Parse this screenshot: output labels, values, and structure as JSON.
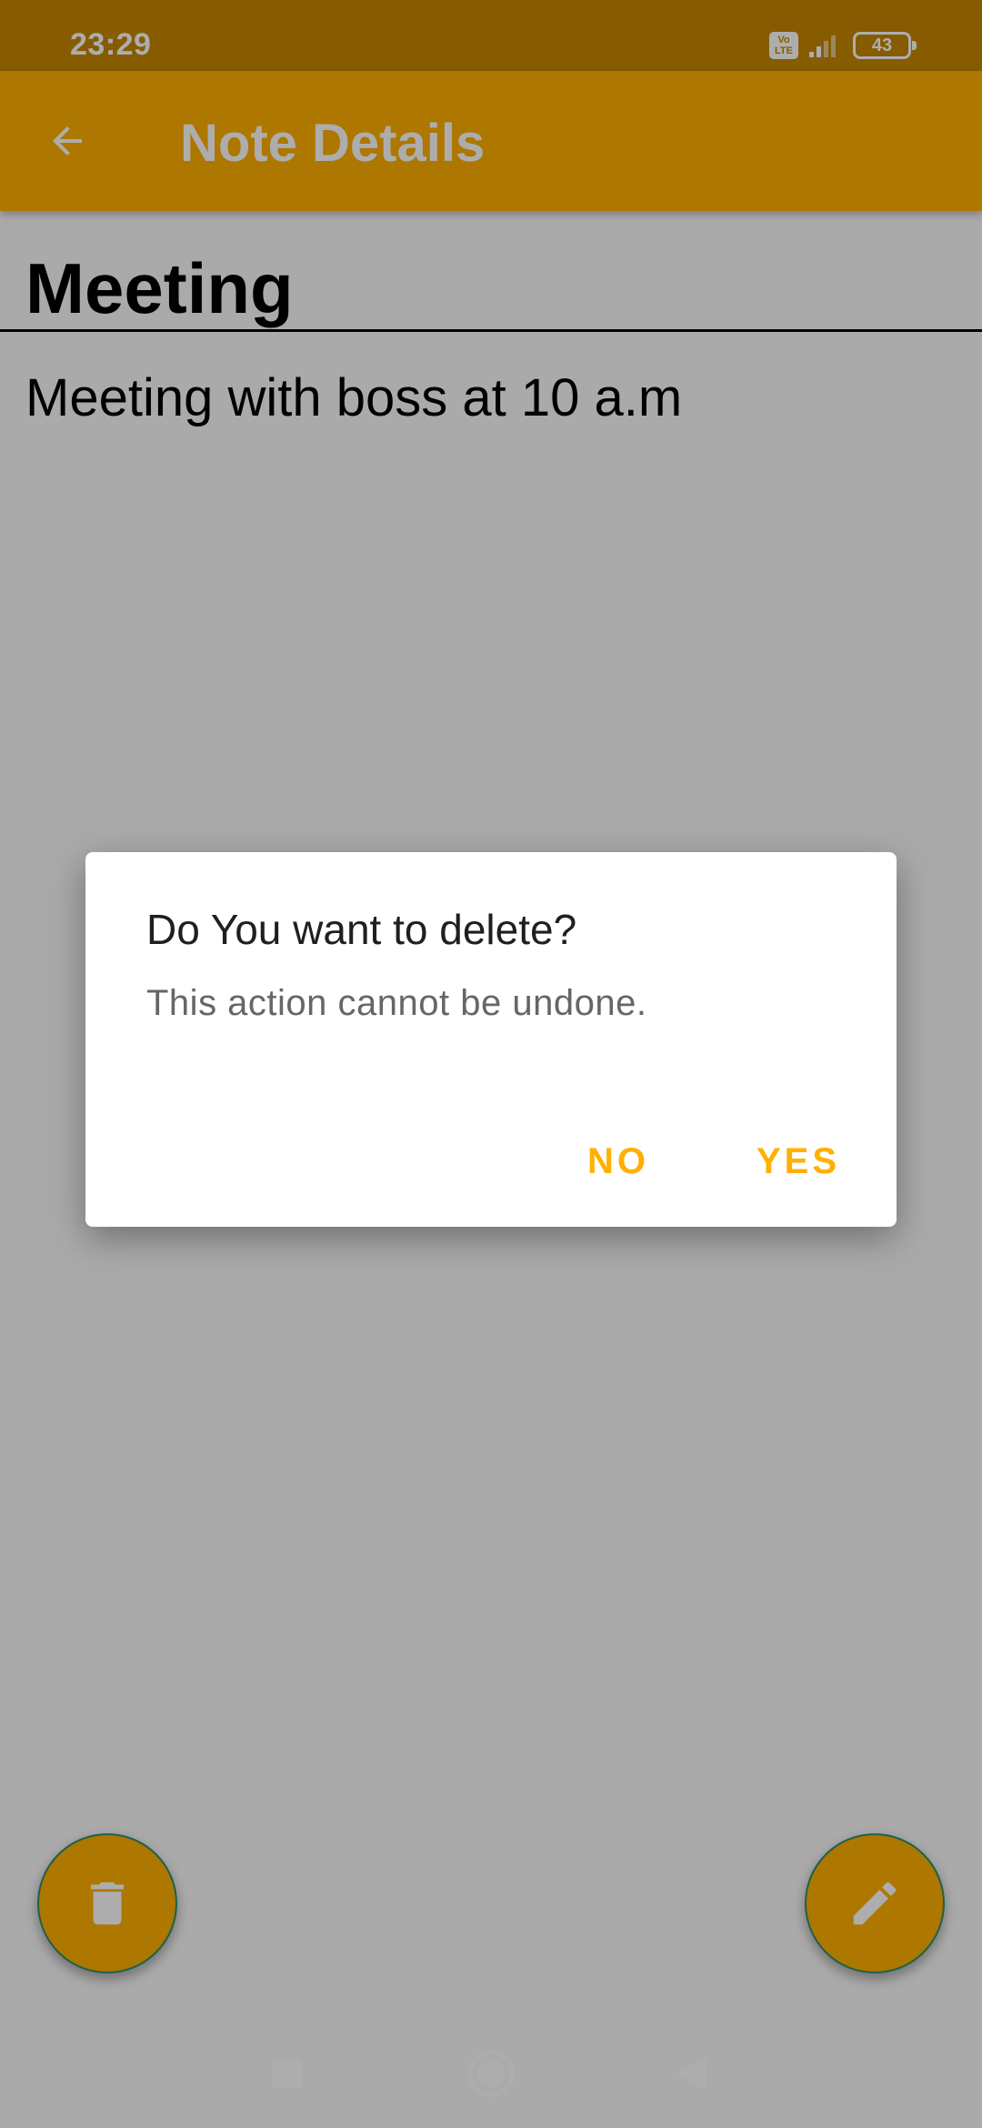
{
  "status_bar": {
    "time": "23:29",
    "volte_top": "Vo",
    "volte_bottom": "LTE",
    "battery_level": "43"
  },
  "app_bar": {
    "title": "Note Details",
    "back_icon": "arrow-back-icon"
  },
  "note": {
    "title": "Meeting",
    "body": "Meeting with boss at 10 a.m"
  },
  "fabs": {
    "delete_icon": "trash-icon",
    "edit_icon": "pencil-icon"
  },
  "dialog": {
    "title": "Do You want to delete?",
    "message": "This action cannot be undone.",
    "negative_label": "NO",
    "positive_label": "YES"
  },
  "colors": {
    "primary": "#ffb000",
    "primary_dark": "#c78700"
  }
}
